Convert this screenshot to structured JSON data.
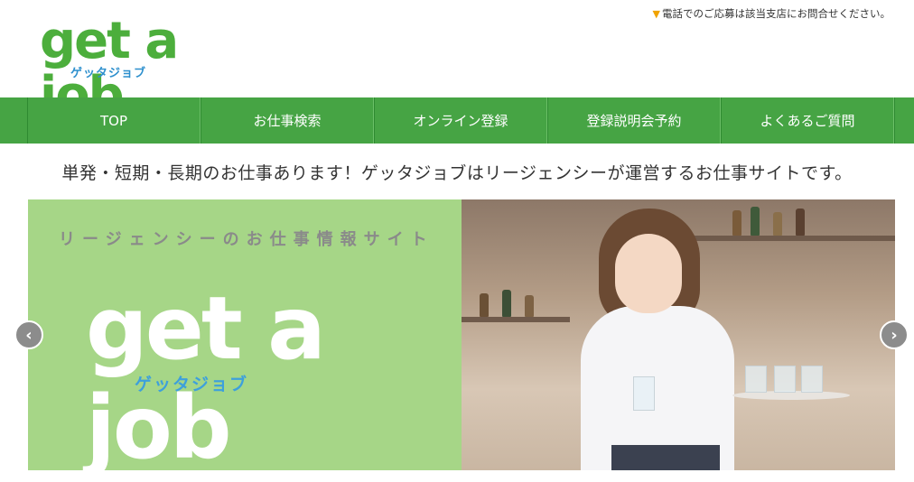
{
  "header": {
    "logo_text": "get a job",
    "logo_kana": "ゲッタジョブ",
    "notice_icon": "triangle-down-icon",
    "notice_text": "電話でのご応募は該当支店にお問合せください。"
  },
  "nav": {
    "items": [
      {
        "label": "TOP"
      },
      {
        "label": "お仕事検索"
      },
      {
        "label": "オンライン登録"
      },
      {
        "label": "登録説明会予約"
      },
      {
        "label": "よくあるご質問"
      }
    ]
  },
  "tagline": "単発・短期・長期のお仕事あります！ゲッタジョブはリージェンシーが運営するお仕事サイトです。",
  "slider": {
    "subtitle": "リージェンシーのお仕事情報サイト",
    "logo_text": "get a job",
    "logo_kana": "ゲッタジョブ",
    "prev_icon": "chevron-left-icon",
    "next_icon": "chevron-right-icon",
    "prev_glyph": "‹",
    "next_glyph": "›"
  },
  "colors": {
    "brand_green": "#46a444",
    "logo_green": "#4cae3c",
    "kana_blue": "#2d8fcd",
    "slide_bg": "#a6d687"
  }
}
